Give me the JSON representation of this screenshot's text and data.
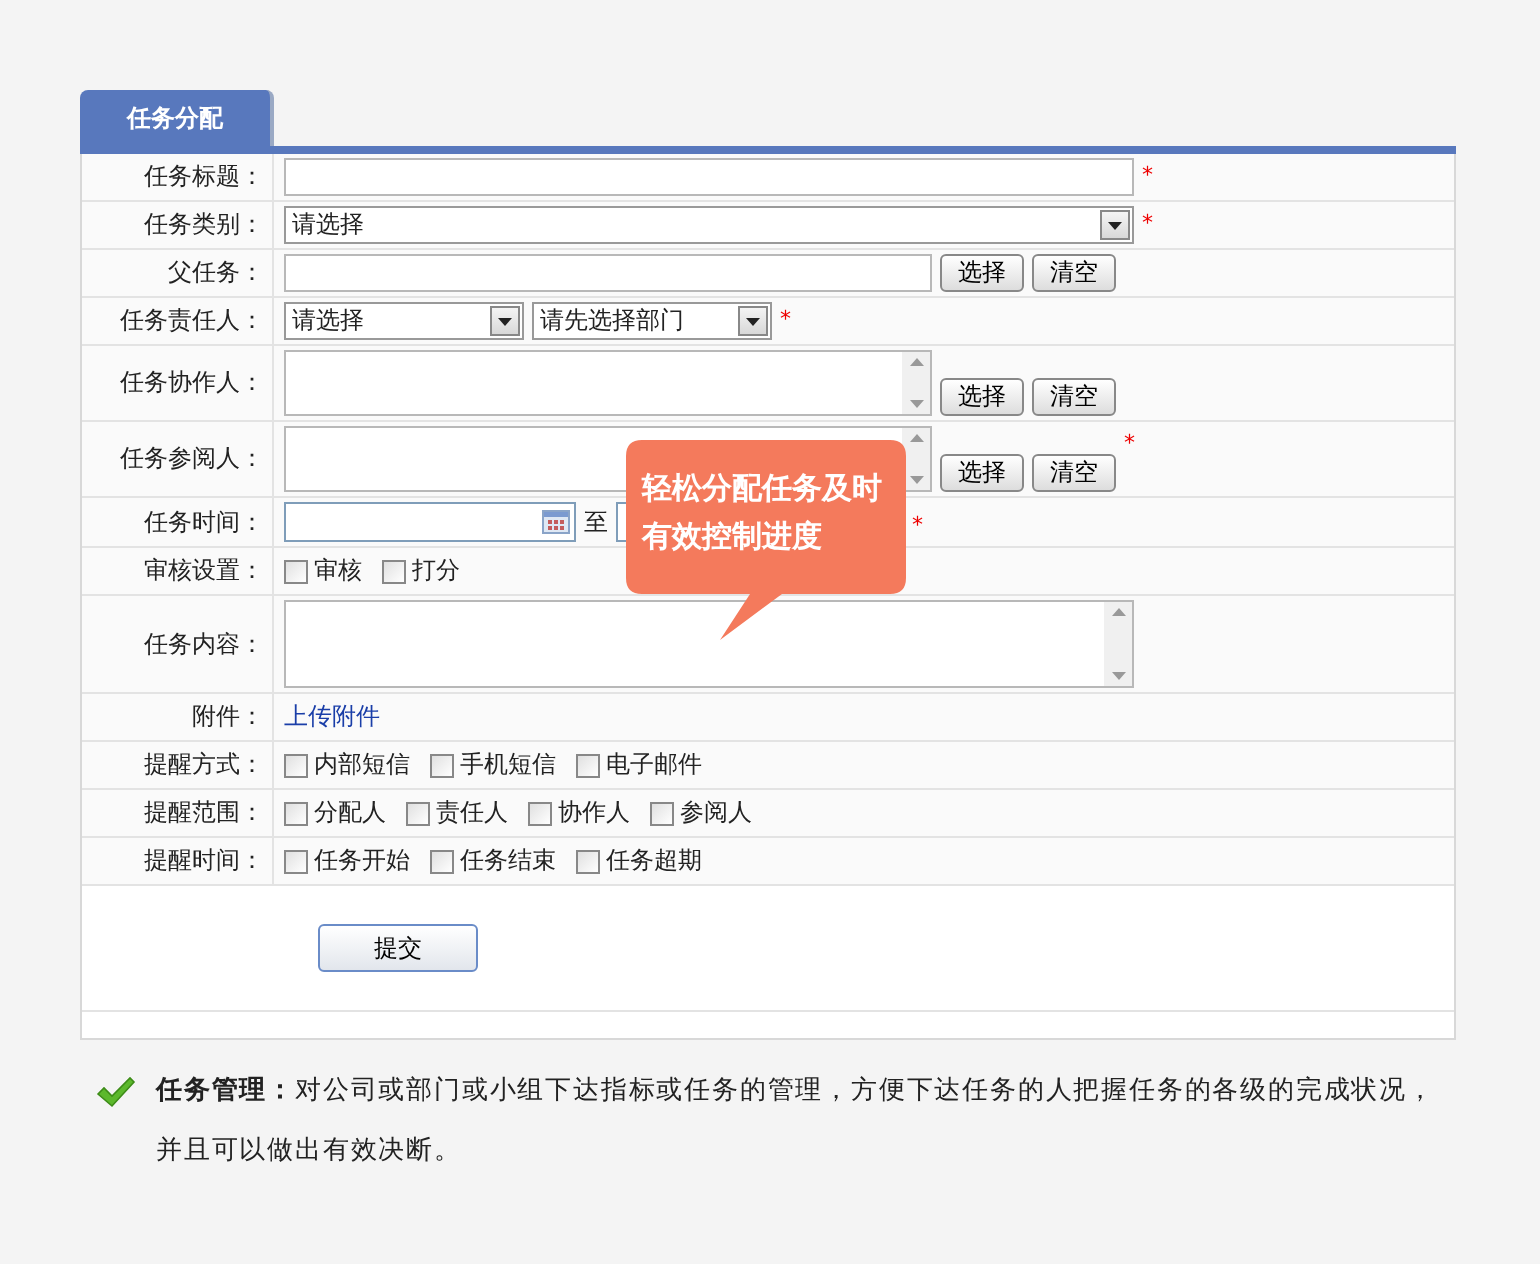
{
  "tab": {
    "label": "任务分配",
    "selected": true
  },
  "rows": [
    {
      "label": "任务标题：",
      "kind": "text",
      "required_mark": "*"
    },
    {
      "label": "任务类别：",
      "kind": "select",
      "values": [
        "请选择"
      ],
      "required_mark": "*"
    },
    {
      "label": "父任务：",
      "kind": "picker",
      "buttons": [
        "选择",
        "清空"
      ]
    },
    {
      "label": "任务责任人：",
      "kind": "selects",
      "values": [
        "请选择",
        "请先选择部门"
      ],
      "required_mark": "*"
    },
    {
      "label": "任务协作人：",
      "kind": "list_picker",
      "buttons": [
        "选择",
        "清空"
      ]
    },
    {
      "label": "任务参阅人：",
      "kind": "list_picker",
      "buttons": [
        "选择",
        "清空"
      ],
      "required_mark": "*"
    },
    {
      "label": "任务时间：",
      "kind": "date_range",
      "separator": "至",
      "required_mark": "*"
    },
    {
      "label": "审核设置：",
      "kind": "checks",
      "options": [
        {
          "label": "审核",
          "checked": false
        },
        {
          "label": "打分",
          "checked": false
        }
      ]
    },
    {
      "label": "任务内容：",
      "kind": "textarea"
    },
    {
      "label": "附件：",
      "kind": "link",
      "link": "上传附件"
    },
    {
      "label": "提醒方式：",
      "kind": "checks",
      "options": [
        {
          "label": "内部短信",
          "checked": false
        },
        {
          "label": "手机短信",
          "checked": false
        },
        {
          "label": "电子邮件",
          "checked": false
        }
      ]
    },
    {
      "label": "提醒范围：",
      "kind": "checks",
      "options": [
        {
          "label": "分配人",
          "checked": false
        },
        {
          "label": "责任人",
          "checked": false
        },
        {
          "label": "协作人",
          "checked": false
        },
        {
          "label": "参阅人",
          "checked": false
        }
      ]
    },
    {
      "label": "提醒时间：",
      "kind": "checks",
      "options": [
        {
          "label": "任务开始",
          "checked": false
        },
        {
          "label": "任务结束",
          "checked": false
        },
        {
          "label": "任务超期",
          "checked": false
        }
      ]
    }
  ],
  "submit": "提交",
  "callout": "轻松分配任务及时有效控制进度",
  "note": "**任务管理：**对公司或部门或小组下达指标或任务的管理，方便下达任务的人把握任务的各级的完成状况，并且可以做出有效决断。"
}
